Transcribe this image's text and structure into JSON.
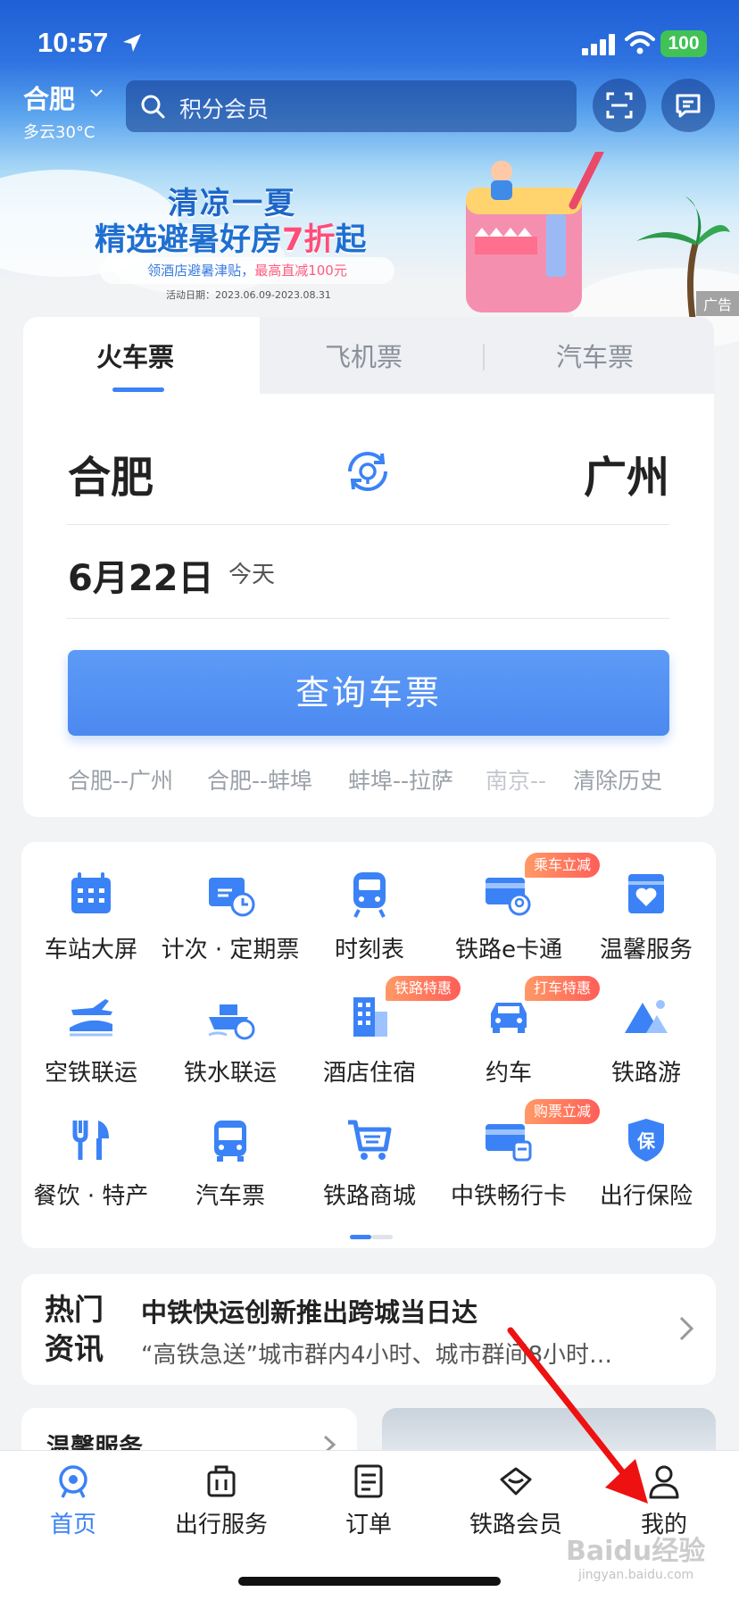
{
  "status_bar": {
    "time": "10:57",
    "battery": "100"
  },
  "header": {
    "city": "合肥",
    "weather": "多云30°C",
    "search_placeholder": "积分会员"
  },
  "promo": {
    "line1": "清凉一夏",
    "line2_a": "精选避暑好房",
    "line2_b": "7折",
    "line2_c": "起",
    "pill_a": "领酒店避暑津贴，",
    "pill_b": "最高直减100元",
    "date": "活动日期：2023.06.09-2023.08.31",
    "ad_label": "广告"
  },
  "ticket": {
    "tabs": [
      "火车票",
      "飞机票",
      "汽车票"
    ],
    "from": "合肥",
    "to": "广州",
    "date": "6月22日",
    "date_sub": "今天",
    "query_button": "查询车票",
    "history": [
      "合肥--广州",
      "合肥--蚌埠",
      "蚌埠--拉萨",
      "南京--",
      "清除历史"
    ]
  },
  "services": [
    {
      "label": "车站大屏",
      "icon": "station-screen-icon",
      "badge": ""
    },
    {
      "label": "计次 · 定期票",
      "icon": "timed-ticket-icon",
      "badge": ""
    },
    {
      "label": "时刻表",
      "icon": "train-icon",
      "badge": ""
    },
    {
      "label": "铁路e卡通",
      "icon": "rail-card-icon",
      "badge": "乘车立减"
    },
    {
      "label": "温馨服务",
      "icon": "heart-service-icon",
      "badge": ""
    },
    {
      "label": "空铁联运",
      "icon": "air-rail-icon",
      "badge": ""
    },
    {
      "label": "铁水联运",
      "icon": "ship-rail-icon",
      "badge": ""
    },
    {
      "label": "酒店住宿",
      "icon": "hotel-icon",
      "badge": "铁路特惠"
    },
    {
      "label": "约车",
      "icon": "car-icon",
      "badge": "打车特惠"
    },
    {
      "label": "铁路游",
      "icon": "mountain-icon",
      "badge": ""
    },
    {
      "label": "餐饮 · 特产",
      "icon": "dining-icon",
      "badge": ""
    },
    {
      "label": "汽车票",
      "icon": "bus-icon",
      "badge": ""
    },
    {
      "label": "铁路商城",
      "icon": "cart-icon",
      "badge": ""
    },
    {
      "label": "中铁畅行卡",
      "icon": "travel-card-icon",
      "badge": "购票立减"
    },
    {
      "label": "出行保险",
      "icon": "insurance-icon",
      "badge": ""
    }
  ],
  "news": {
    "tag": "热门资讯",
    "title": "中铁快运创新推出跨城当日达",
    "subtitle": "“高铁急送”城市群内4小时、城市群间8小时…"
  },
  "bottom_cards": {
    "left_title": "温馨服务"
  },
  "tabbar": [
    {
      "label": "首页",
      "icon": "home-icon"
    },
    {
      "label": "出行服务",
      "icon": "luggage-icon"
    },
    {
      "label": "订单",
      "icon": "order-icon"
    },
    {
      "label": "铁路会员",
      "icon": "member-icon"
    },
    {
      "label": "我的",
      "icon": "profile-icon"
    }
  ],
  "watermark": {
    "main": "Baidu经验",
    "sub": "jingyan.baidu.com"
  },
  "colors": {
    "primary": "#3b82f6",
    "badge": "#ff6b5a",
    "annotation": "#ee1111"
  }
}
